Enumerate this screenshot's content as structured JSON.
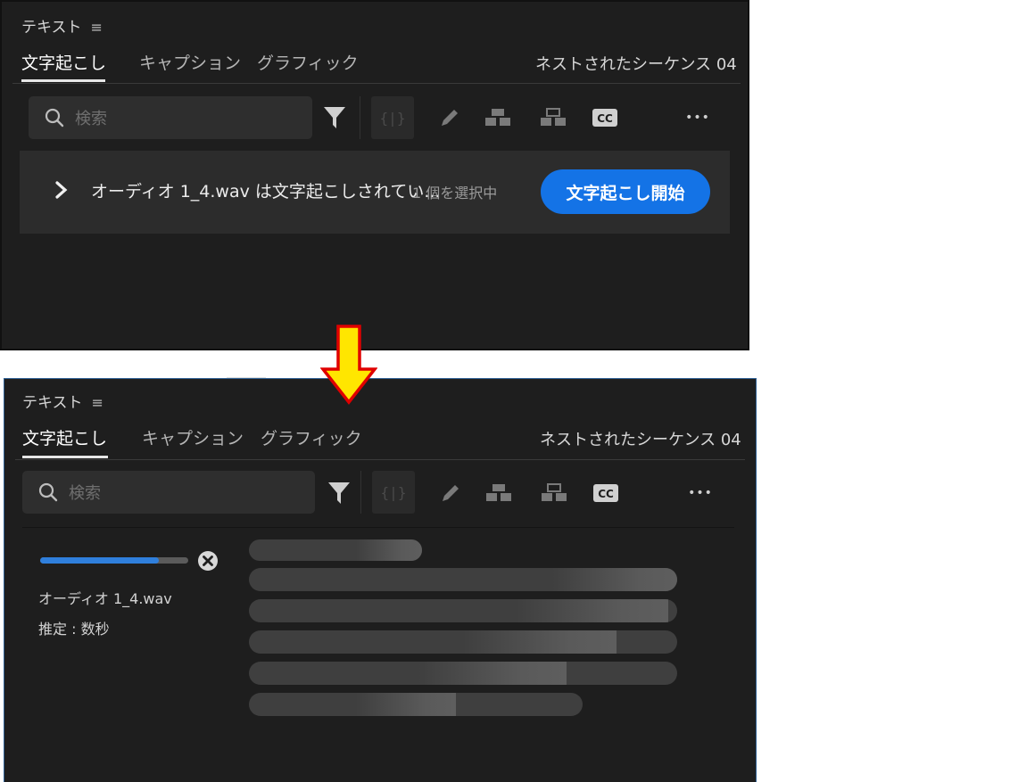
{
  "before": {
    "panel_title": "テキスト",
    "menu_glyph": "≡",
    "tabs": [
      {
        "label": "文字起こし"
      },
      {
        "label": "キャプション"
      },
      {
        "label": "グラフィック"
      }
    ],
    "sequence_name": "ネストされたシーケンス 04",
    "search_placeholder": "検索",
    "toolbar": {
      "cc_label": "CC",
      "more_glyph": "•••"
    },
    "banner": {
      "message": "オーディオ 1_4.wav は文字起こしされてい...",
      "selection_count": "1 個を選択中",
      "start_button": "文字起こし開始"
    }
  },
  "after": {
    "panel_title": "テキスト",
    "menu_glyph": "≡",
    "tabs": [
      {
        "label": "文字起こし"
      },
      {
        "label": "キャプション"
      },
      {
        "label": "グラフィック"
      }
    ],
    "sequence_name": "ネストされたシーケンス 04",
    "search_placeholder": "検索",
    "toolbar": {
      "cc_label": "CC",
      "more_glyph": "•••"
    },
    "progress": {
      "fraction": 0.8,
      "file_name": "オーディオ 1_4.wav",
      "estimate": "推定 : 数秒"
    }
  },
  "colors": {
    "panel_bg": "#1e1e1e",
    "accent_blue": "#1473e6",
    "progress_blue": "#2f7fdc",
    "arrow_fill": "#ffe600",
    "arrow_stroke": "#e00000"
  },
  "icons": [
    "search-icon",
    "filter-icon",
    "split-icon",
    "pencil-icon",
    "merge-icon",
    "split-clip-icon",
    "cc-icon",
    "more-icon",
    "chevron-right-icon",
    "close-icon",
    "down-arrow-icon"
  ]
}
